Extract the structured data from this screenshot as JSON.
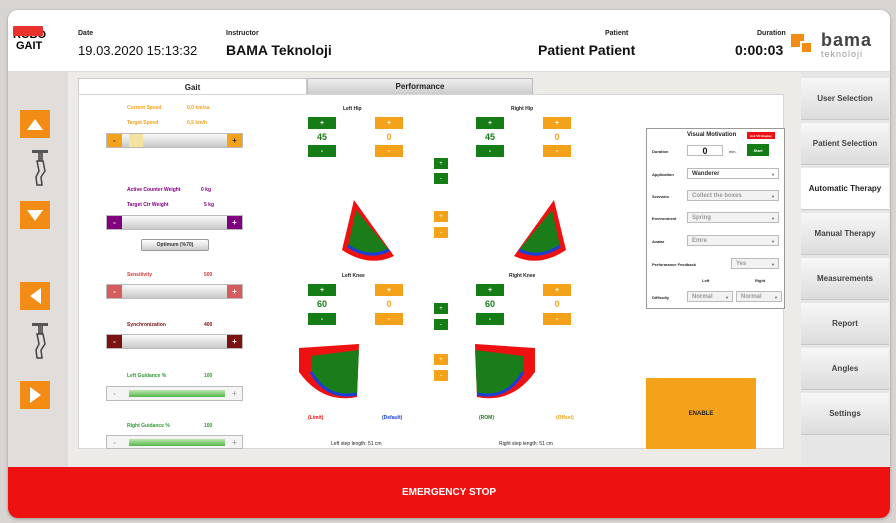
{
  "logo": {
    "line1": "ROBO",
    "line2": "GAIT"
  },
  "header": {
    "date_label": "Date",
    "date_value": "19.03.2020  15:13:32",
    "instructor_label": "Instructor",
    "instructor_value": "BAMA Teknoloji",
    "patient_label": "Patient",
    "patient_value": "Patient Patient",
    "duration_label": "Duration",
    "duration_value": "0:00:03",
    "brand_name": "bama",
    "brand_sub": "teknoloji"
  },
  "tabs": {
    "gait": "Gait",
    "performance": "Performance"
  },
  "gait_params": {
    "current_speed_label": "Current Speed",
    "current_speed_value": "0,0 km/sa",
    "target_speed_label": "Target Speed",
    "target_speed_value": "0,5 km/h",
    "active_cw_label": "Active Counter Weight",
    "active_cw_value": "0 kg",
    "target_cw_label": "Target Ctr Weight",
    "target_cw_value": "5 kg",
    "optimum_label": "Optimum (%70)",
    "sensitivity_label": "Sensitivity",
    "sensitivity_value": "500",
    "sync_label": "Synchronization",
    "sync_value": "400",
    "left_guid_label": "Left Guidance %",
    "left_guid_value": "100",
    "right_guid_label": "Right Guidance %",
    "right_guid_value": "100",
    "minus": "-",
    "plus": "+"
  },
  "joints": {
    "left_hip": {
      "title": "Left Hip",
      "green_value": "45",
      "orange_value": "0"
    },
    "right_hip": {
      "title": "Right Hip",
      "green_value": "45",
      "orange_value": "0"
    },
    "left_knee": {
      "title": "Left Knee",
      "green_value": "60",
      "orange_value": "0"
    },
    "right_knee": {
      "title": "Right Knee",
      "green_value": "60",
      "orange_value": "0"
    },
    "plus": "+",
    "minus": "-",
    "legend_left": [
      "(Limit)",
      "(Default)"
    ],
    "legend_right": [
      "(ROM)",
      "(Offset)"
    ],
    "left_step": "Left step length: 51 cm",
    "right_step": "Right step length: 51 cm"
  },
  "visual_motivation": {
    "title": "Visual Motivation",
    "badge": "Ask VR display",
    "duration_label": "Duration",
    "duration_value": "0",
    "duration_unit": "min.",
    "start_label": "Start",
    "application_label": "Application",
    "application_value": "Wanderer",
    "scenario_label": "Scenario",
    "scenario_value": "Collect the boxes",
    "environment_label": "Environment",
    "environment_value": "Spring",
    "avatar_label": "Avatar",
    "avatar_value": "Emre",
    "feedback_label": "Performance Feedback",
    "feedback_value": "Yes",
    "left_col": "Left",
    "right_col": "Right",
    "difficulty_label": "Difficulty",
    "difficulty_left": "Normal",
    "difficulty_right": "Normal"
  },
  "enable_label": "ENABLE",
  "sidebar": [
    "User Selection",
    "Patient Selection",
    "Automatic Therapy",
    "Manual Therapy",
    "Measurements",
    "Report",
    "Angles",
    "Settings"
  ],
  "emergency_label": "EMERGENCY STOP",
  "colors": {
    "orange": "#f28c14",
    "green": "#167d16",
    "red": "#ee1111"
  },
  "icons": {
    "up": "arrow-up-icon",
    "down": "arrow-down-icon",
    "left": "arrow-left-icon",
    "right": "arrow-right-icon",
    "robot": "robot-leg-icon"
  }
}
